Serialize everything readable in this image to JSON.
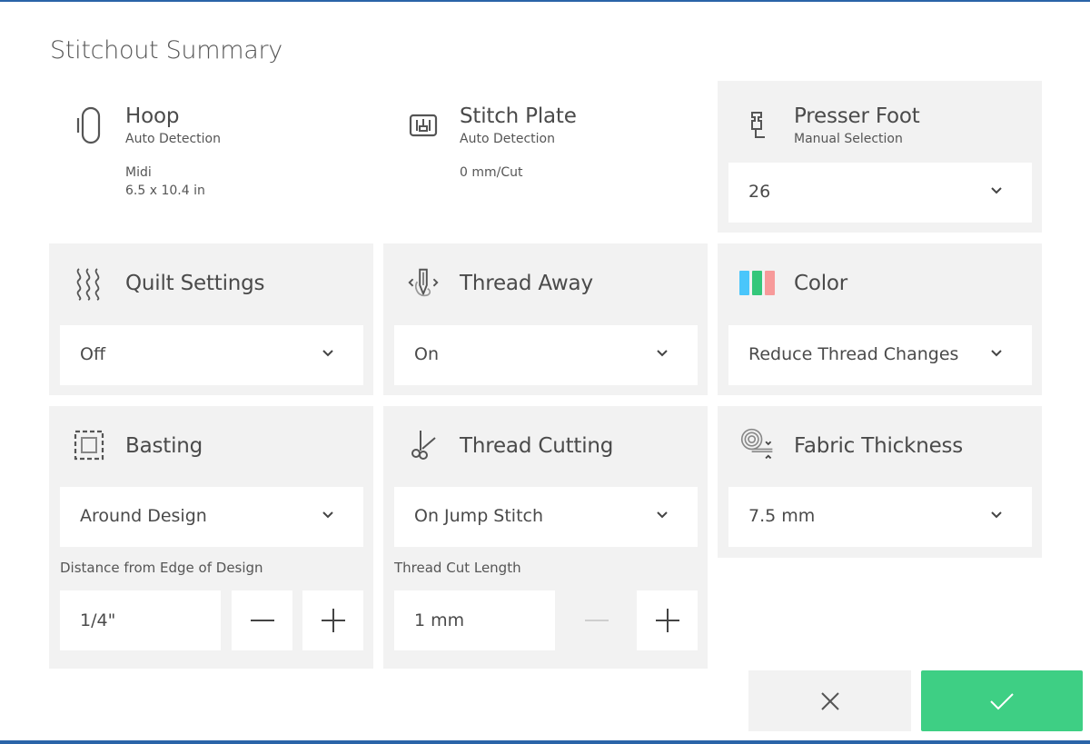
{
  "title": "Stitchout Summary",
  "colors": {
    "accent_green": "#3ecf84",
    "frame_blue": "#2a64a8",
    "panel_gray": "#f2f2f2",
    "color_icon": [
      "#4ac6fb",
      "#35c77a",
      "#f79a9a"
    ]
  },
  "hoop": {
    "icon": "hoop-icon",
    "title": "Hoop",
    "subtitle": "Auto Detection",
    "size_name": "Midi",
    "dimensions": "6.5 x 10.4 in"
  },
  "stitch_plate": {
    "icon": "stitch-plate-icon",
    "title": "Stitch Plate",
    "subtitle": "Auto Detection",
    "value": "0 mm/Cut"
  },
  "presser_foot": {
    "icon": "presser-foot-icon",
    "title": "Presser Foot",
    "subtitle": "Manual Selection",
    "selected": "26"
  },
  "quilt_settings": {
    "icon": "quilt-icon",
    "title": "Quilt Settings",
    "selected": "Off"
  },
  "thread_away": {
    "icon": "thread-away-icon",
    "title": "Thread Away",
    "selected": "On"
  },
  "color": {
    "icon": "color-bars-icon",
    "title": "Color",
    "selected": "Reduce Thread Changes"
  },
  "basting": {
    "icon": "basting-icon",
    "title": "Basting",
    "selected": "Around Design",
    "distance_label": "Distance from Edge of Design",
    "distance_value": "1/4\""
  },
  "thread_cutting": {
    "icon": "scissors-icon",
    "title": "Thread Cutting",
    "selected": "On Jump Stitch",
    "length_label": "Thread Cut Length",
    "length_value": "1 mm",
    "decrement_disabled": true
  },
  "fabric_thickness": {
    "icon": "fabric-roll-icon",
    "title": "Fabric Thickness",
    "selected": "7.5 mm"
  },
  "actions": {
    "cancel_icon": "close-icon",
    "confirm_icon": "check-icon"
  }
}
